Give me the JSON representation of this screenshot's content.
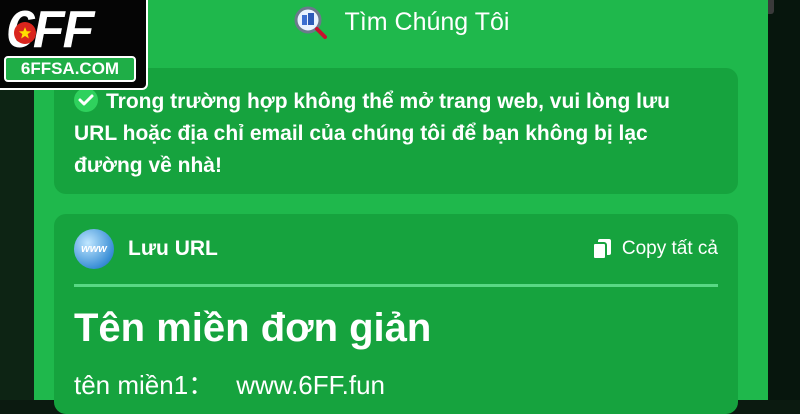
{
  "header": {
    "title": "Tìm Chúng Tôi"
  },
  "logo": {
    "main": "6FF",
    "site": "6FFSA.COM"
  },
  "notice": {
    "text": "Trong trường hợp không thể mở trang web, vui lòng lưu URL hoặc địa chỉ email của chúng tôi để bạn không bị lạc đường về nhà!"
  },
  "url_card": {
    "icon_text": "www",
    "title": "Lưu URL",
    "copy_all": "Copy tất cả",
    "section_title": "Tên miền đơn giản",
    "domains": [
      {
        "label": "tên miền1：",
        "url": "www.6FF.fun"
      }
    ]
  },
  "colors": {
    "panel": "#1fb84c",
    "card": "#16a33e",
    "divider": "#58d884"
  }
}
